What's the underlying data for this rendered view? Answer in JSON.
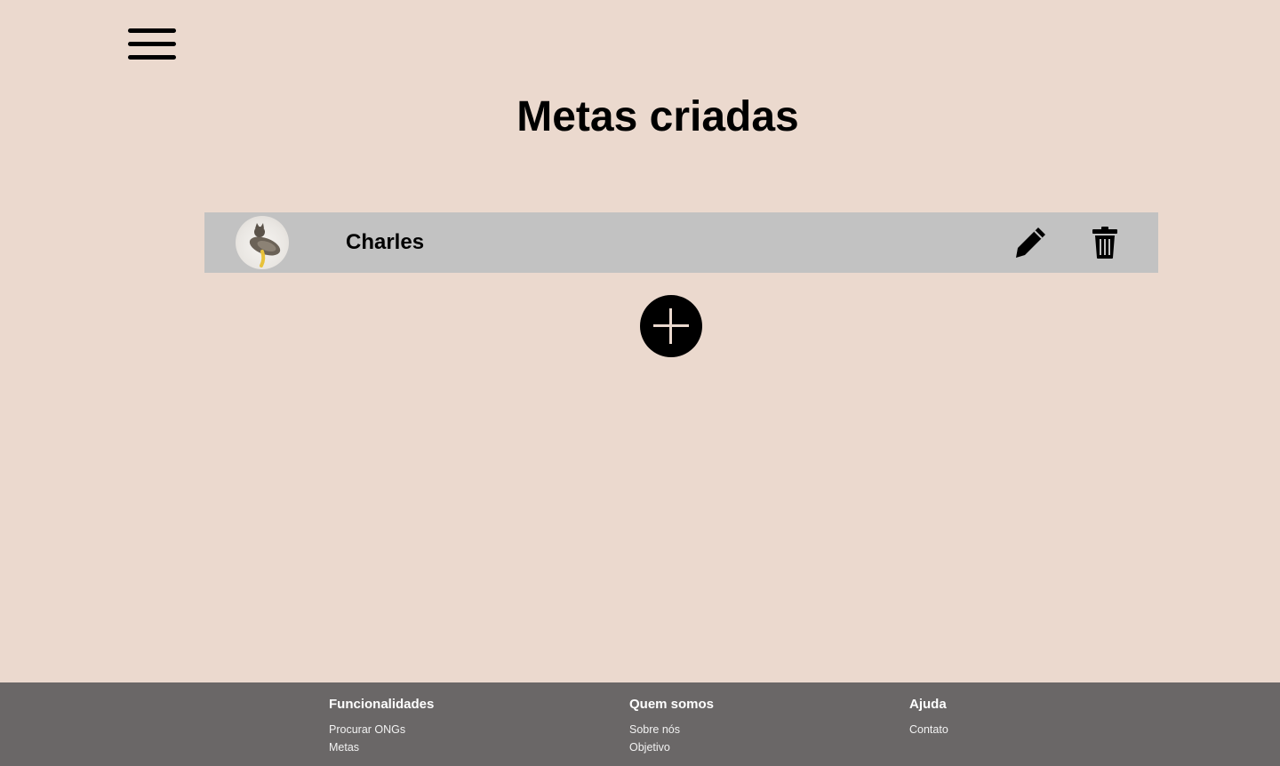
{
  "header": {
    "menu_icon": "hamburger-menu-icon"
  },
  "page": {
    "title": "Metas criadas"
  },
  "goals": [
    {
      "name": "Charles",
      "avatar": "cat-photo",
      "edit_icon": "pencil-icon",
      "delete_icon": "trash-icon"
    }
  ],
  "add_button": {
    "icon": "plus-icon"
  },
  "footer": {
    "columns": [
      {
        "title": "Funcionalidades",
        "links": [
          "Procurar ONGs",
          "Metas"
        ]
      },
      {
        "title": "Quem somos",
        "links": [
          "Sobre nós",
          "Objetivo"
        ]
      },
      {
        "title": "Ajuda",
        "links": [
          "Contato"
        ]
      }
    ]
  },
  "colors": {
    "background": "#ebd9ce",
    "row": "#c2c2c2",
    "footer": "#6a6767"
  }
}
